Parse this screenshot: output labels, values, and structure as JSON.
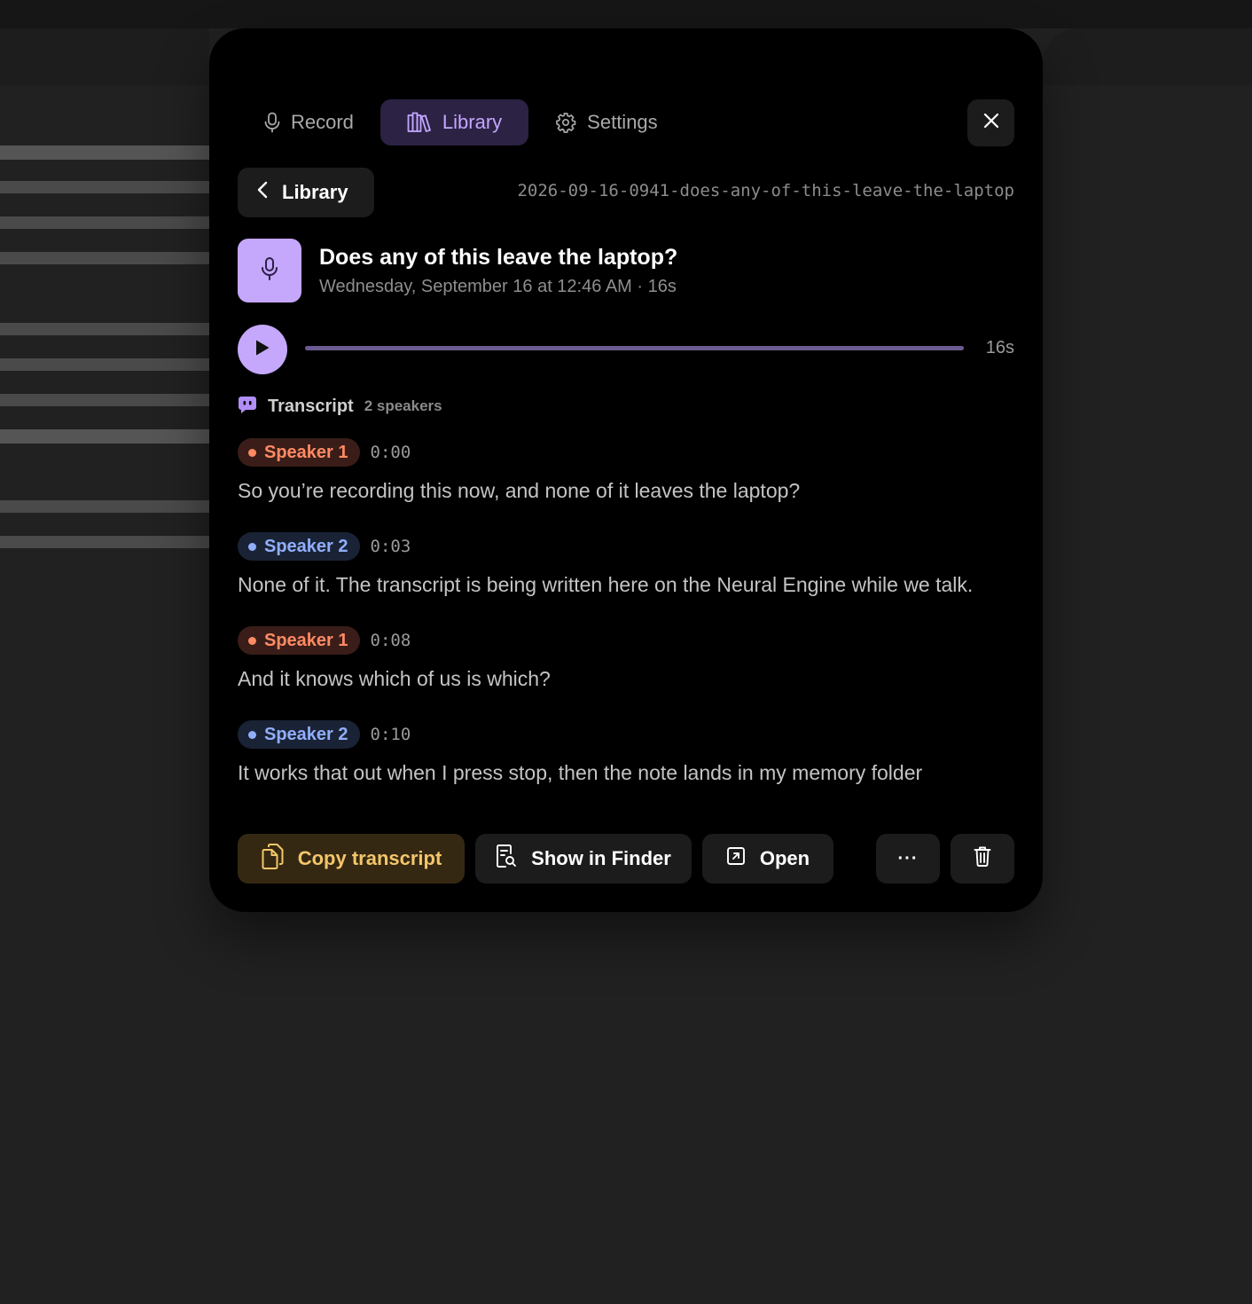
{
  "tabs": [
    {
      "label": "Record",
      "icon": "microphone-icon",
      "active": false
    },
    {
      "label": "Library",
      "icon": "books-icon",
      "active": true
    },
    {
      "label": "Settings",
      "icon": "gear-icon",
      "active": false
    }
  ],
  "nav": {
    "back_label": "Library"
  },
  "recording": {
    "filename": "2026-09-16-0941-does-any-of-this-leave-the-laptop",
    "title": "Does any of this leave the laptop?",
    "meta": "Wednesday, September 16 at 12:46 AM · 16s"
  },
  "player": {
    "duration": "16s",
    "progress": 1.0
  },
  "transcript": {
    "label": "Transcript",
    "speakers": "2 speakers",
    "entries": [
      {
        "speaker": "Speaker 1",
        "time": "0:00",
        "text": "So you’re recording this now, and none of it leaves the laptop?"
      },
      {
        "speaker": "Speaker 2",
        "time": "0:03",
        "text": "None of it. The transcript is being written here on the Neural Engine while we talk."
      },
      {
        "speaker": "Speaker 1",
        "time": "0:08",
        "text": "And it knows which of us is which?"
      },
      {
        "speaker": "Speaker 2",
        "time": "0:10",
        "text": "It works that out when I press stop, then the note lands in my memory folder"
      }
    ]
  },
  "actions": {
    "copy_label": "Copy transcript",
    "finder_label": "Show in Finder",
    "open_label": "Open",
    "more_label": "···"
  },
  "colors": {
    "accent": "#c5a7fb",
    "speaker1": "#ff8a63",
    "speaker2": "#91aefc",
    "copy": "#f3c66a"
  }
}
